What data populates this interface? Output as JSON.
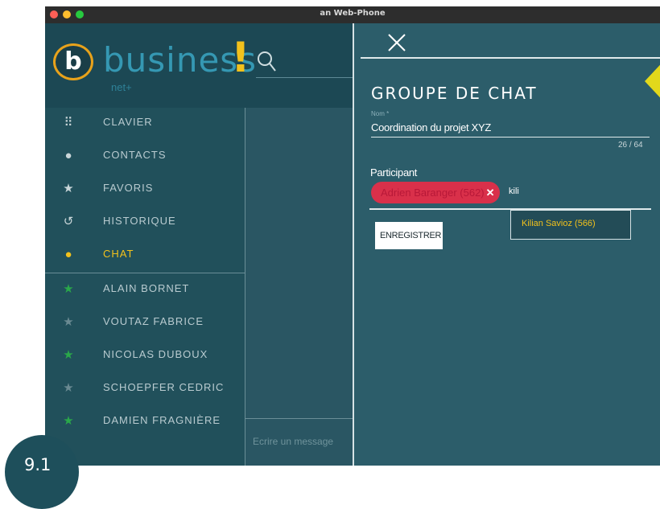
{
  "window": {
    "title": "an Web-Phone"
  },
  "brand": {
    "name": "business",
    "accent": "!",
    "sub": "net+"
  },
  "nav": {
    "items": [
      {
        "icon": "keypad-icon",
        "label": "CLAVIER"
      },
      {
        "icon": "contact-icon",
        "label": "CONTACTS"
      },
      {
        "icon": "star-icon",
        "label": "FAVORIS"
      },
      {
        "icon": "history-icon",
        "label": "HISTORIQUE"
      },
      {
        "icon": "chat-icon",
        "label": "CHAT"
      }
    ],
    "contacts": [
      {
        "name": "ALAIN BORNET",
        "color": "#2aa84a"
      },
      {
        "name": "VOUTAZ FABRICE",
        "color": "#6a8a92"
      },
      {
        "name": "NICOLAS DUBOUX",
        "color": "#2aa84a"
      },
      {
        "name": "SCHOEPFER CEDRIC",
        "color": "#6a8a92"
      },
      {
        "name": "DAMIEN FRAGNIÈRE",
        "color": "#2aa84a"
      }
    ]
  },
  "message": {
    "placeholder": "Ecrire un message"
  },
  "panel": {
    "title": "GROUPE DE CHAT",
    "name_label": "Nom *",
    "name_value": "Coordination du projet XYZ",
    "counter": "26 / 64",
    "participant_label": "Participant",
    "chip": "Adrien Baranger (562)",
    "chip_remove": "✕",
    "input_value": "kili",
    "suggestion": "Kilian Savioz (566)",
    "save": "ENREGISTRER"
  },
  "badge": {
    "text": "9.1"
  },
  "colors": {
    "accent_yellow": "#f2c11c",
    "chip_red": "#d9304a",
    "panel_bg": "#2c5d6a",
    "arrow": "#e2d81b"
  }
}
